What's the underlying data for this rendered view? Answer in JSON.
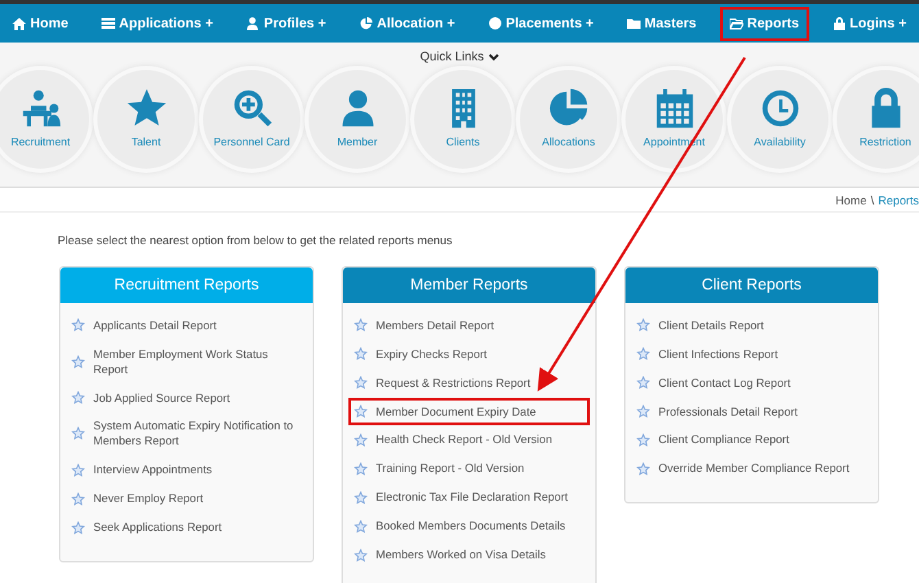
{
  "nav": [
    {
      "label": "Home",
      "highlighted": false
    },
    {
      "label": "Applications +",
      "highlighted": false
    },
    {
      "label": "Profiles +",
      "highlighted": false
    },
    {
      "label": "Allocation +",
      "highlighted": false
    },
    {
      "label": "Placements +",
      "highlighted": false
    },
    {
      "label": "Masters",
      "highlighted": false
    },
    {
      "label": "Reports",
      "highlighted": true
    },
    {
      "label": "Logins +",
      "highlighted": false
    }
  ],
  "quick_links": {
    "title": "Quick Links",
    "items": [
      {
        "label": "Recruitment"
      },
      {
        "label": "Talent"
      },
      {
        "label": "Personnel Card"
      },
      {
        "label": "Member"
      },
      {
        "label": "Clients"
      },
      {
        "label": "Allocations"
      },
      {
        "label": "Appointment"
      },
      {
        "label": "Availability"
      },
      {
        "label": "Restriction"
      }
    ]
  },
  "breadcrumb": {
    "items": [
      "Home",
      "Reports"
    ],
    "separator": "\\"
  },
  "intro": "Please select the nearest option from below to get the related reports menus",
  "cards": [
    {
      "title": "Recruitment Reports",
      "color": "#00aee8",
      "items": [
        {
          "label": "Applicants Detail Report",
          "highlighted": false
        },
        {
          "label": "Member Employment Work Status Report",
          "highlighted": false
        },
        {
          "label": "Job Applied Source Report",
          "highlighted": false
        },
        {
          "label": "System Automatic Expiry Notification to Members Report",
          "highlighted": false
        },
        {
          "label": "Interview Appointments",
          "highlighted": false
        },
        {
          "label": "Never Employ Report",
          "highlighted": false
        },
        {
          "label": "Seek Applications Report",
          "highlighted": false
        }
      ]
    },
    {
      "title": "Member Reports",
      "color": "#0a86b8",
      "items": [
        {
          "label": "Members Detail Report",
          "highlighted": false
        },
        {
          "label": "Expiry Checks Report",
          "highlighted": false
        },
        {
          "label": "Request & Restrictions Report",
          "highlighted": false
        },
        {
          "label": "Member Document Expiry Date",
          "highlighted": true
        },
        {
          "label": "Health Check Report - Old Version",
          "highlighted": false
        },
        {
          "label": "Training Report - Old Version",
          "highlighted": false
        },
        {
          "label": "Electronic Tax File Declaration Report",
          "highlighted": false
        },
        {
          "label": "Booked Members Documents Details",
          "highlighted": false
        },
        {
          "label": "Members Worked on Visa Details",
          "highlighted": false
        }
      ]
    },
    {
      "title": "Client Reports",
      "color": "#0a86b8",
      "items": [
        {
          "label": "Client Details Report",
          "highlighted": false
        },
        {
          "label": "Client Infections Report",
          "highlighted": false
        },
        {
          "label": "Client Contact Log Report",
          "highlighted": false
        },
        {
          "label": "Professionals Detail Report",
          "highlighted": false
        },
        {
          "label": "Client Compliance Report",
          "highlighted": false
        },
        {
          "label": "Override Member Compliance Report",
          "highlighted": false
        }
      ]
    }
  ]
}
